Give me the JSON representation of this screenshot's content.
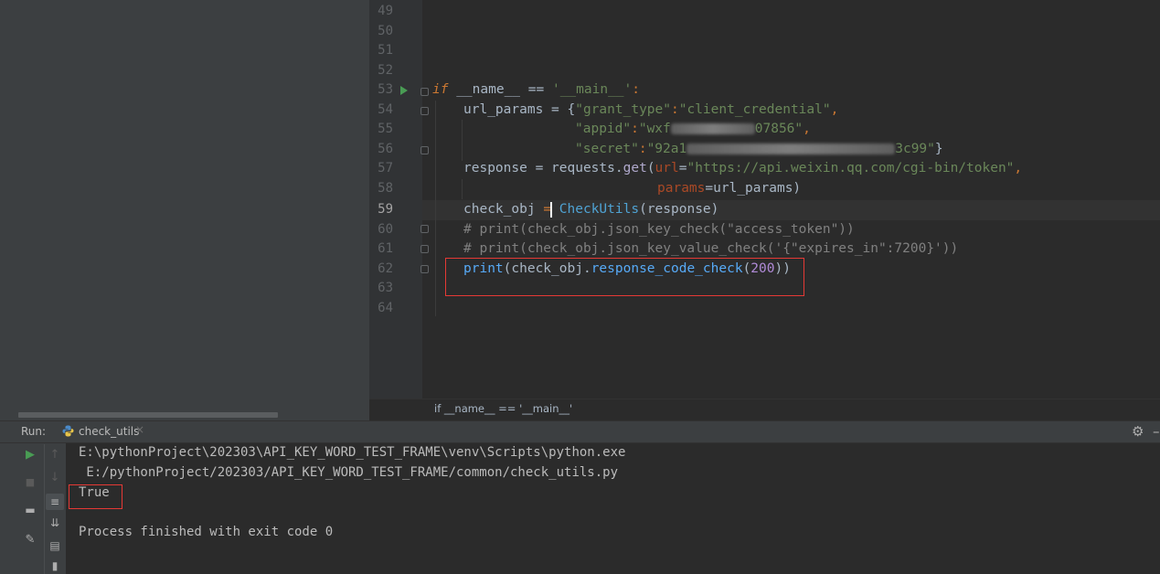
{
  "editor": {
    "lines": [
      {
        "n": "49"
      },
      {
        "n": "50"
      },
      {
        "n": "51"
      },
      {
        "n": "52"
      },
      {
        "n": "53"
      },
      {
        "n": "54"
      },
      {
        "n": "55"
      },
      {
        "n": "56"
      },
      {
        "n": "57"
      },
      {
        "n": "58"
      },
      {
        "n": "59"
      },
      {
        "n": "60"
      },
      {
        "n": "61"
      },
      {
        "n": "62"
      },
      {
        "n": "63"
      },
      {
        "n": "64"
      }
    ],
    "code": {
      "l53_kw": "if",
      "l53_rest": " __name__ == ",
      "l53_str": "'__main__'",
      "l53_colon": ":",
      "l54_var": "url_params",
      "l54_eq": " = {",
      "l54_k": "\"grant_type\"",
      "l54_colon": ":",
      "l54_v": "\"client_credential\"",
      "l54_comma": ",",
      "l55_k": "\"appid\"",
      "l55_colon": ":",
      "l55_v_start": "\"wxf",
      "l55_v_end": "07856\"",
      "l55_comma": ",",
      "l56_k": "\"secret\"",
      "l56_colon": ":",
      "l56_v_start": "\"92a1",
      "l56_v_end": "3c99\"",
      "l56_close": "}",
      "l57_var": "response",
      "l57_eq": " = requests.",
      "l57_fn": "get",
      "l57_open": "(",
      "l57_param": "url",
      "l57_eq2": "=",
      "l57_str": "\"https://api.weixin.qq.com/cgi-bin/token\"",
      "l57_comma": ",",
      "l58_param": "params",
      "l58_eq": "=",
      "l58_rest": "url_params)",
      "l59_var": "check_obj ",
      "l59_eq": "= ",
      "l59_cls": "CheckUtils",
      "l59_rest": "(response)",
      "l60_comment": "# print(check_obj.json_key_check(\"access_token\"))",
      "l61_comment": "# print(check_obj.json_key_value_check('{\"expires_in\":7200}'))",
      "l62_print": "print",
      "l62_a": "(check_obj.",
      "l62_method": "response_code_check",
      "l62_b": "(",
      "l62_num": "200",
      "l62_c": "))"
    },
    "breadcrumb": "if __name__ == '__main__'"
  },
  "run": {
    "label": "Run:",
    "tab_label": "check_utils",
    "tab_close": "×",
    "output": [
      "E:\\pythonProject\\202303\\API_KEY_WORD_TEST_FRAME\\venv\\Scripts\\python.exe",
      " E:/pythonProject/202303/API_KEY_WORD_TEST_FRAME/common/check_utils.py",
      "True",
      "",
      "Process finished with exit code 0"
    ]
  },
  "colors": {
    "red_highlight": "#e53935",
    "run_green": "#499c54"
  },
  "icons": [
    "run-gutter-icon",
    "fold-icon",
    "python-icon",
    "gear-icon",
    "rerun-icon",
    "stop-icon",
    "scroll-up-icon",
    "scroll-down-icon",
    "soft-wrap-icon",
    "scroll-to-end-icon",
    "layout-icon",
    "print-icon",
    "pin-icon",
    "trash-icon"
  ]
}
